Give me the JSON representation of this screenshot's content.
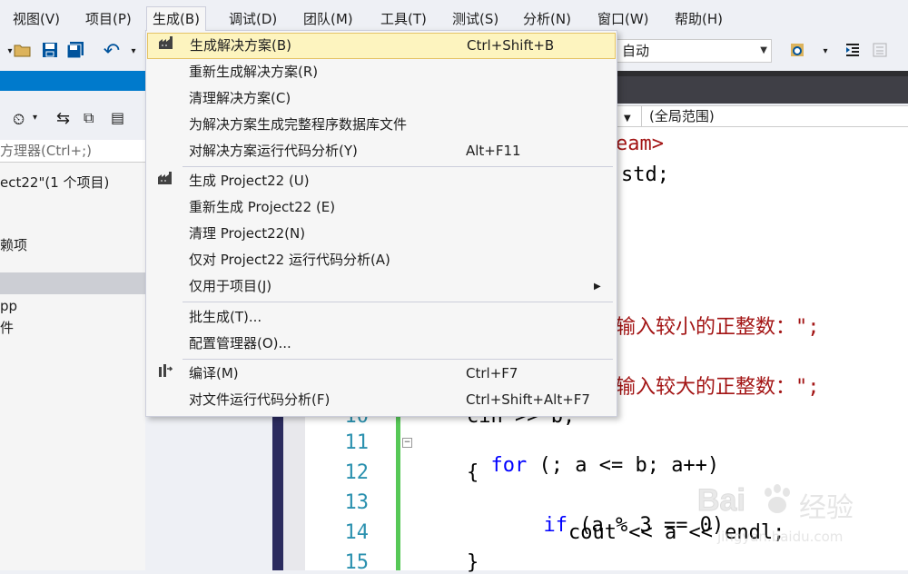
{
  "menubar": {
    "items": [
      "视图(V)",
      "项目(P)",
      "生成(B)",
      "调试(D)",
      "团队(M)",
      "工具(T)",
      "测试(S)",
      "分析(N)",
      "窗口(W)",
      "帮助(H)"
    ]
  },
  "toolbar": {
    "platform_combo": "自动"
  },
  "solution_explorer": {
    "search_placeholder": "方理器(Ctrl+;)",
    "tree": [
      "ect22\"(1 个项目)",
      "赖项",
      "pp",
      "件"
    ]
  },
  "editor": {
    "nav_scope": "(全局范围)",
    "code_fragments": {
      "include_tail": "eam>",
      "using_tail": "std;",
      "prompt1_tail": "输入较小的正整数：\";",
      "prompt2_tail": "输入较大的正整数：\";",
      "line10_tail": "cin >> b;"
    },
    "lines": [
      {
        "num": "10",
        "code": ""
      },
      {
        "num": "11",
        "code": "for (; a <= b; a++)"
      },
      {
        "num": "12",
        "code": "{"
      },
      {
        "num": "13",
        "code": "if (a % 3 == 0)"
      },
      {
        "num": "14",
        "code": "cout << a << endl;"
      },
      {
        "num": "15",
        "code": "}"
      }
    ],
    "keywords": {
      "for": "for",
      "if": "if"
    }
  },
  "build_menu": {
    "items": [
      {
        "label": "生成解决方案(B)",
        "shortcut": "Ctrl+Shift+B",
        "icon": "build-solution-icon"
      },
      {
        "label": "重新生成解决方案(R)",
        "shortcut": ""
      },
      {
        "label": "清理解决方案(C)",
        "shortcut": ""
      },
      {
        "label": "为解决方案生成完整程序数据库文件",
        "shortcut": ""
      },
      {
        "label": "对解决方案运行代码分析(Y)",
        "shortcut": "Alt+F11"
      },
      {
        "label": "生成 Project22 (U)",
        "shortcut": "",
        "icon": "build-project-icon"
      },
      {
        "label": "重新生成 Project22 (E)",
        "shortcut": ""
      },
      {
        "label": "清理 Project22(N)",
        "shortcut": ""
      },
      {
        "label": "仅对 Project22 运行代码分析(A)",
        "shortcut": ""
      },
      {
        "label": "仅用于项目(J)",
        "shortcut": "",
        "submenu": true
      },
      {
        "label": "批生成(T)...",
        "shortcut": ""
      },
      {
        "label": "配置管理器(O)...",
        "shortcut": ""
      },
      {
        "label": "编译(M)",
        "shortcut": "Ctrl+F7",
        "icon": "compile-icon"
      },
      {
        "label": "对文件运行代码分析(F)",
        "shortcut": "Ctrl+Shift+Alt+F7"
      }
    ]
  },
  "watermark": {
    "brand": "Bai",
    "brand2": "经验",
    "url": "jingyan.baidu.com"
  },
  "colors": {
    "accent": "#007acc",
    "highlight": "#fdf4bf",
    "keyword": "#0000ff",
    "string": "#a31515",
    "line_number": "#2b91af"
  }
}
